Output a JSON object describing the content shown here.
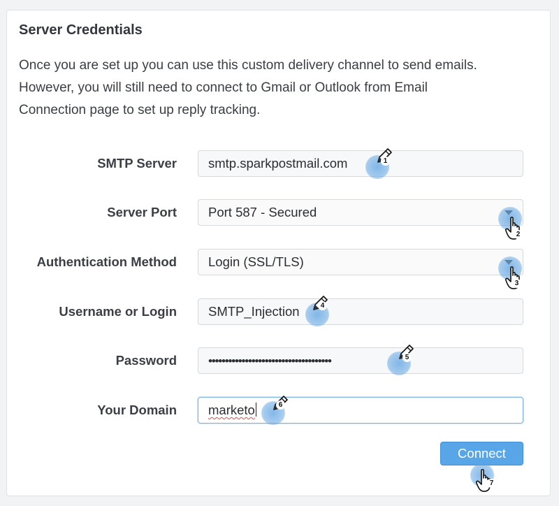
{
  "panel": {
    "title": "Server Credentials",
    "description_lines": [
      "Once you are set up you can use this custom delivery channel to send emails.",
      "However, you will still need to connect to Gmail or Outlook from Email",
      "Connection page to set up reply tracking."
    ]
  },
  "form": {
    "smtp_server": {
      "label": "SMTP Server",
      "value": "smtp.sparkpostmail.com"
    },
    "server_port": {
      "label": "Server Port",
      "value": "Port 587 - Secured"
    },
    "auth_method": {
      "label": "Authentication Method",
      "value": "Login (SSL/TLS)"
    },
    "username": {
      "label": "Username or Login",
      "value": "SMTP_Injection"
    },
    "password": {
      "label": "Password",
      "value": "•••••••••••••••••••••••••••••••••••••"
    },
    "domain": {
      "label": "Your Domain",
      "value": "marketo"
    }
  },
  "connect_button": {
    "label": "Connect"
  },
  "steps": [
    "1",
    "2",
    "3",
    "4",
    "5",
    "6",
    "7"
  ],
  "icons": {
    "edit": "pencil-cursor-icon",
    "click": "hand-pointer-icon",
    "dropdown": "caret-down-icon"
  },
  "colors": {
    "accent": "#58a6e8",
    "callout": "#60a4e2",
    "focus_border": "#7fb6e6"
  }
}
